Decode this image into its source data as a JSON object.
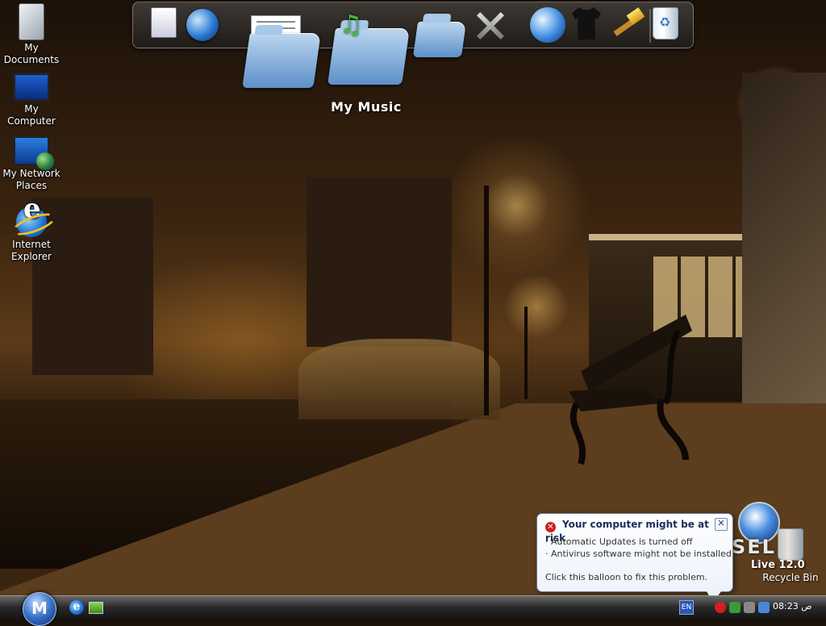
{
  "desktop_icons": [
    {
      "id": "my-documents",
      "label": "My Documents"
    },
    {
      "id": "my-computer",
      "label": "My Computer"
    },
    {
      "id": "my-network-places",
      "label": "My Network Places"
    },
    {
      "id": "internet-explorer",
      "label": "Internet Explorer"
    }
  ],
  "dock": {
    "hover_label": "My Music",
    "items": [
      {
        "name": "document-viewer-icon"
      },
      {
        "name": "network-globe-icon"
      },
      {
        "name": "documents-folder-icon"
      },
      {
        "name": "music-folder-icon"
      },
      {
        "name": "pictures-folder-icon"
      },
      {
        "name": "tools-icon"
      },
      {
        "name": "internet-globe-icon"
      },
      {
        "name": "tshirt-icon"
      },
      {
        "name": "hammer-icon"
      },
      {
        "name": "recycle-bin-icon"
      }
    ]
  },
  "balloon": {
    "title": "Your computer might be at risk",
    "line1": "· Automatic Updates is turned off",
    "line2": "· Antivirus software might not be installed",
    "line3": "Click this balloon to fix this problem.",
    "close": "✕"
  },
  "branding": {
    "logo_text": "SEL",
    "version_label": "Live 12.0"
  },
  "recycle_bin_label": "Recycle Bin",
  "taskbar": {
    "start_label": "M",
    "language": "EN",
    "clock": "08:23 ص"
  }
}
